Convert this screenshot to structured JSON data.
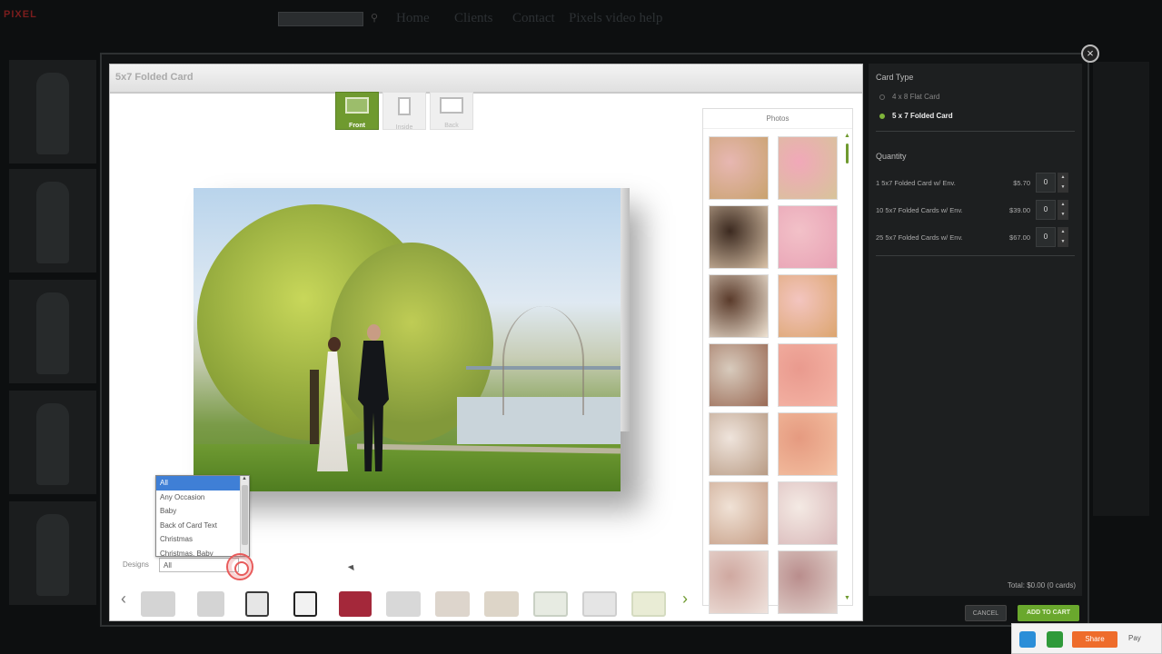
{
  "background": {
    "nav_links": [
      "Home",
      "Clients",
      "Contact",
      "Pixels video help"
    ]
  },
  "modal": {
    "title": "5x7 Folded Card",
    "close_glyph": "×"
  },
  "view_tabs": [
    {
      "label": "Front",
      "active": true
    },
    {
      "label": "Inside",
      "active": false
    },
    {
      "label": "Back",
      "active": false
    }
  ],
  "designs": {
    "label": "Designs",
    "selected": "All",
    "options": [
      "All",
      "Any Occasion",
      "Baby",
      "Back of Card Text",
      "Christmas",
      "Christmas, Baby"
    ]
  },
  "carousel": {
    "prev": "‹",
    "next": "›",
    "thumbs": [
      {
        "color": "#d4d4d4",
        "border": "#d4d4d4"
      },
      {
        "color": "#d4d4d4",
        "border": "#d4d4d4"
      },
      {
        "color": "#e6e6e6",
        "border": "#3a3a3a"
      },
      {
        "color": "#f2f2f2",
        "border": "#222"
      },
      {
        "color": "#a4283a",
        "border": "#a4283a"
      },
      {
        "color": "#d8d8d8",
        "border": "#d8d8d8"
      },
      {
        "color": "#ddd5cc",
        "border": "#ddd5cc"
      },
      {
        "color": "#ddd5c8",
        "border": "#ddd5c8"
      },
      {
        "color": "#e7ebe2",
        "border": "#c9d0c4"
      },
      {
        "color": "#e5e5e5",
        "border": "#cfcfcf"
      },
      {
        "color": "#e9ecd5",
        "border": "#d4dbc0"
      }
    ]
  },
  "photos": {
    "title": "Photos",
    "items": [
      {
        "c1": "#e7b7b2",
        "c2": "#c9a26e"
      },
      {
        "c1": "#f1a8b9",
        "c2": "#d7c49a"
      },
      {
        "c1": "#3c2a20",
        "c2": "#d9c2a8"
      },
      {
        "c1": "#f2c1c8",
        "c2": "#e8a1b4"
      },
      {
        "c1": "#5a3b2b",
        "c2": "#efe3d3"
      },
      {
        "c1": "#f3c5c0",
        "c2": "#dca56e"
      },
      {
        "c1": "#d8cbbd",
        "c2": "#9a6a55"
      },
      {
        "c1": "#e99a8e",
        "c2": "#f5b5a6"
      },
      {
        "c1": "#efe4dc",
        "c2": "#b89b84"
      },
      {
        "c1": "#e59a80",
        "c2": "#f4c1a2"
      },
      {
        "c1": "#f0e2d6",
        "c2": "#c69e86"
      },
      {
        "c1": "#f4eae4",
        "c2": "#d8b7b8"
      },
      {
        "c1": "#cfa8a0",
        "c2": "#efe3dd"
      },
      {
        "c1": "#b98d8c",
        "c2": "#e4d6d0"
      }
    ]
  },
  "sidebar": {
    "card_type_heading": "Card Type",
    "card_types": [
      {
        "label": "4 x 8 Flat Card",
        "checked": false
      },
      {
        "label": "5 x 7 Folded Card",
        "checked": true
      }
    ],
    "quantity_heading": "Quantity",
    "quantities": [
      {
        "name": "1 5x7 Folded Card w/ Env.",
        "price": "$5.70",
        "qty": "0"
      },
      {
        "name": "10 5x7 Folded Cards w/ Env.",
        "price": "$39.00",
        "qty": "0"
      },
      {
        "name": "25 5x7 Folded Cards w/ Env.",
        "price": "$67.00",
        "qty": "0"
      }
    ],
    "total": "Total: $0.00 (0 cards)",
    "cancel_label": "CANCEL",
    "add_label": "ADD TO CART"
  },
  "share": {
    "share_label": "Share",
    "more_label": "Pay"
  }
}
